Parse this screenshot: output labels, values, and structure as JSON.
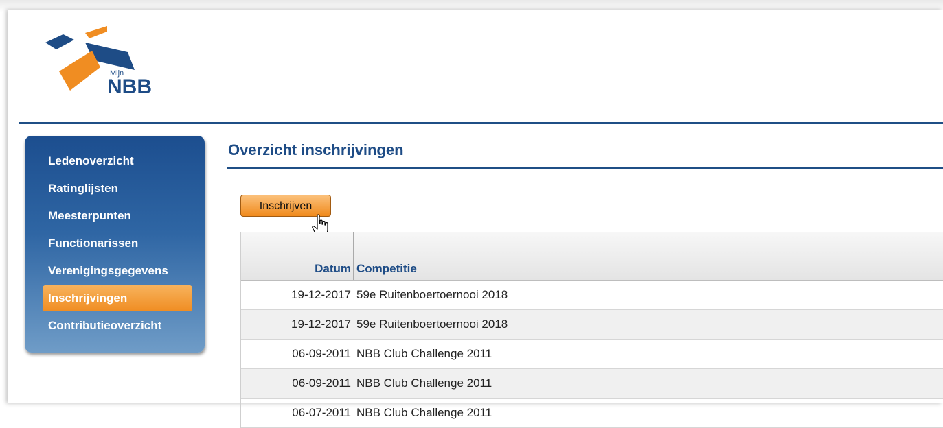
{
  "logo": {
    "small_text": "Mijn",
    "big_text": "NBB"
  },
  "sidebar": {
    "items": [
      {
        "label": "Ledenoverzicht",
        "active": false
      },
      {
        "label": "Ratinglijsten",
        "active": false
      },
      {
        "label": "Meesterpunten",
        "active": false
      },
      {
        "label": "Functionarissen",
        "active": false
      },
      {
        "label": "Verenigingsgegevens",
        "active": false
      },
      {
        "label": "Inschrijvingen",
        "active": true
      },
      {
        "label": "Contributieoverzicht",
        "active": false
      }
    ]
  },
  "main": {
    "title": "Overzicht inschrijvingen",
    "button_label": "Inschrijven",
    "table": {
      "columns": [
        "Datum",
        "Competitie"
      ],
      "rows": [
        {
          "datum": "19-12-2017",
          "competitie": "59e Ruitenboertoernooi 2018"
        },
        {
          "datum": "19-12-2017",
          "competitie": "59e Ruitenboertoernooi 2018"
        },
        {
          "datum": "06-09-2011",
          "competitie": "NBB Club Challenge 2011"
        },
        {
          "datum": "06-09-2011",
          "competitie": "NBB Club Challenge 2011"
        },
        {
          "datum": "06-07-2011",
          "competitie": "NBB Club Challenge 2011"
        }
      ]
    }
  },
  "colors": {
    "brand_blue": "#1e4c86",
    "brand_orange": "#f08d22"
  }
}
